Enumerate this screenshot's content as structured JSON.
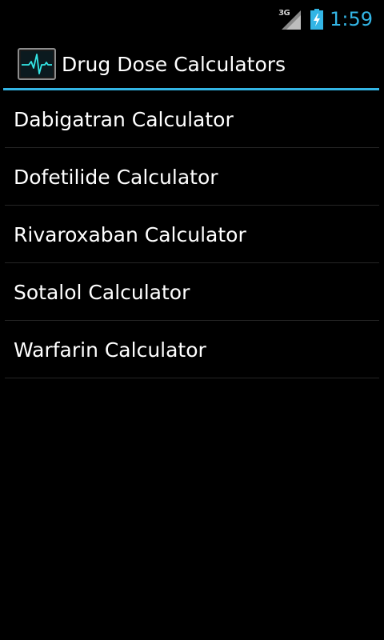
{
  "status_bar": {
    "network_type": "3G",
    "time": "1:59",
    "icons": [
      "signal-icon",
      "battery-charging-icon"
    ]
  },
  "action_bar": {
    "icon": "heartbeat-monitor-icon",
    "title": "Drug Dose Calculators"
  },
  "list": {
    "items": [
      {
        "label": "Dabigatran Calculator"
      },
      {
        "label": "Dofetilide Calculator"
      },
      {
        "label": "Rivaroxaban Calculator"
      },
      {
        "label": "Sotalol Calculator"
      },
      {
        "label": "Warfarin Calculator"
      }
    ]
  },
  "colors": {
    "background": "#000000",
    "accent": "#33b5e5",
    "text": "#ffffff",
    "divider": "#242424"
  }
}
